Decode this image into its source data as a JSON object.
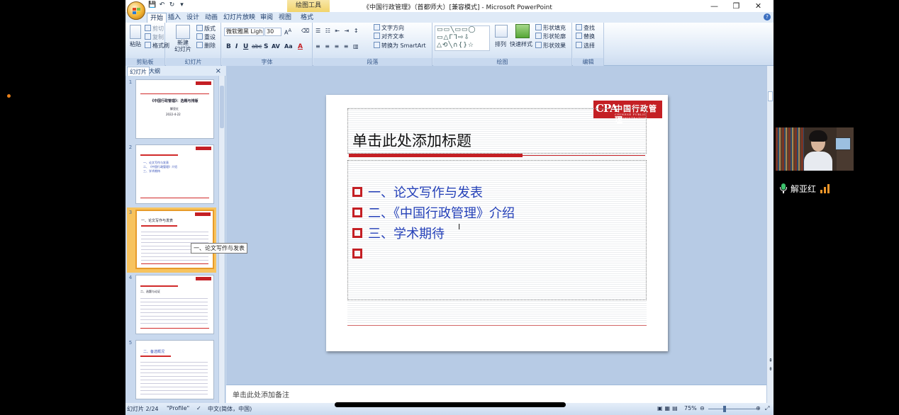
{
  "window": {
    "title": "《中国行政管理》（首都师大）[兼容模式] - Microsoft PowerPoint",
    "context_tools": "绘图工具",
    "buttons": [
      "—",
      "❐",
      "✕"
    ]
  },
  "ribbon": {
    "tabs": [
      "开始",
      "插入",
      "设计",
      "动画",
      "幻灯片放映",
      "审阅",
      "视图",
      "格式"
    ],
    "active_tab": "开始",
    "clipboard": {
      "paste": "粘贴",
      "cut": "剪切",
      "copy": "复制",
      "format_painter": "格式刷",
      "group": "剪贴板"
    },
    "slides": {
      "new_slide": "新建\n幻灯片",
      "layout": "版式",
      "reset": "重设",
      "delete": "删除",
      "group": "幻灯片"
    },
    "font": {
      "name": "微软雅黑 Ligh",
      "size": "30",
      "group": "字体"
    },
    "paragraph": {
      "text_direction": "文字方向",
      "align_text": "对齐文本",
      "smartart": "转换为 SmartArt",
      "group": "段落"
    },
    "drawing": {
      "arrange": "排列",
      "quick_styles": "快速样式",
      "shape_fill": "形状填充",
      "shape_outline": "形状轮廓",
      "shape_effects": "形状效果",
      "group": "绘图"
    },
    "editing": {
      "find": "查找",
      "replace": "替换",
      "select": "选择",
      "group": "编辑"
    }
  },
  "panel": {
    "tabs": [
      "幻灯片",
      "大纲"
    ],
    "thumbnails": [
      {
        "num": "1",
        "lines": [
          "《中国行政管理》：选题与排版",
          "解亚红",
          "2022-4-22"
        ]
      },
      {
        "num": "2",
        "lines": [
          "一、论文写作与发表",
          "二、《中国行政管理》介绍",
          "三、学术期待"
        ]
      },
      {
        "num": "3",
        "lines": [
          "一、论文写作与发表"
        ]
      },
      {
        "num": "4",
        "lines": [
          "二、选题与论证"
        ]
      },
      {
        "num": "5",
        "lines": [
          "二、备选概况"
        ]
      }
    ],
    "selected": "3",
    "tooltip": "一、论文写作与发表"
  },
  "slide": {
    "logo_big": "CPA",
    "logo_cn": "中国行政管理",
    "logo_en": "CHINESE PUBLIC ADMINISTRATION",
    "title": "单击此处添加标题",
    "bullets": [
      "一、论文写作与发表",
      "二、《中国行政管理》介绍",
      "三、学术期待",
      ""
    ],
    "cursor": "I"
  },
  "notes": "单击此处添加备注",
  "status": {
    "slide_count": "幻灯片 2/24",
    "theme": "\"Profile\"",
    "language": "中文(简体，中国)",
    "zoom": "75%"
  },
  "video": {
    "participant": "解亚红",
    "mic_color": "#3bc16b",
    "signal_color": "#f0962a"
  },
  "colors": {
    "accent_red": "#c41f24",
    "bullet_blue": "#2440b8"
  }
}
